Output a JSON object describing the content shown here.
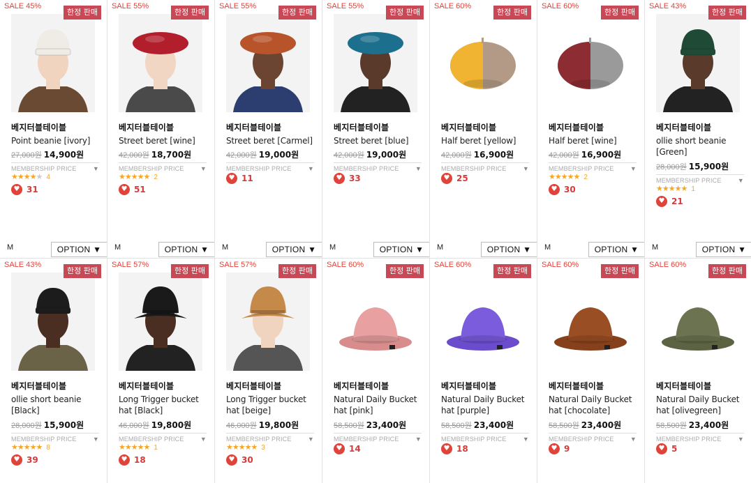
{
  "common": {
    "limited_label": "한정 판매",
    "brand": "베지터블테이블",
    "membership_label": "MEMBERSHIP PRICE",
    "membership_arrow": "▼",
    "option_size": "M",
    "option_label": "OPTION ▼"
  },
  "colors": {
    "sale": "#e0433a",
    "badge": "#c94856",
    "star": "#f5a623",
    "heart": "#e0433a"
  },
  "products": [
    {
      "sale": "SALE 45%",
      "name": "Point beanie [ivory]",
      "old": "27,000원",
      "price": "14,900원",
      "stars_filled": 4,
      "review_count": "4",
      "likes": "31",
      "kind": "beanie",
      "c1": "#efece6",
      "c2": "#6b4a33",
      "skin": "#f0d4c0"
    },
    {
      "sale": "SALE 55%",
      "name": "Street beret [wine]",
      "old": "42,000원",
      "price": "18,700원",
      "stars_filled": 5,
      "review_count": "2",
      "likes": "51",
      "kind": "beret",
      "c1": "#b31e2c",
      "c2": "#4a4a4a",
      "skin": "#f2d6c4"
    },
    {
      "sale": "SALE 55%",
      "name": "Street beret [Carmel]",
      "old": "42,000원",
      "price": "19,000원",
      "stars_filled": 0,
      "review_count": "",
      "likes": "11",
      "kind": "beret",
      "c1": "#b8542a",
      "c2": "#2c3e70",
      "skin": "#6b4532"
    },
    {
      "sale": "SALE 55%",
      "name": "Street beret [blue]",
      "old": "42,000원",
      "price": "19,000원",
      "stars_filled": 0,
      "review_count": "",
      "likes": "33",
      "kind": "beret",
      "c1": "#1d6f8e",
      "c2": "#222",
      "skin": "#5a3a2a"
    },
    {
      "sale": "SALE 60%",
      "name": "Half beret [yellow]",
      "old": "42,000원",
      "price": "16,900원",
      "stars_filled": 0,
      "review_count": "",
      "likes": "25",
      "kind": "halfberet",
      "c1": "#f0b432",
      "c2": "#b39a86",
      "skin": ""
    },
    {
      "sale": "SALE 60%",
      "name": "Half beret [wine]",
      "old": "42,000원",
      "price": "16,900원",
      "stars_filled": 5,
      "review_count": "2",
      "likes": "30",
      "kind": "halfberet",
      "c1": "#8e2c33",
      "c2": "#9a9a9a",
      "skin": ""
    },
    {
      "sale": "SALE 43%",
      "name": "ollie short beanie [Green]",
      "old": "28,000원",
      "price": "15,900원",
      "stars_filled": 5,
      "review_count": "1",
      "likes": "21",
      "kind": "beanie",
      "c1": "#1f4a35",
      "c2": "#222",
      "skin": "#5a3a2a"
    },
    {
      "sale": "SALE 43%",
      "name": "ollie short beanie [Black]",
      "old": "28,000원",
      "price": "15,900원",
      "stars_filled": 5,
      "review_count": "8",
      "likes": "39",
      "kind": "beanie",
      "c1": "#1c1c1c",
      "c2": "#6b6347",
      "skin": "#4a2e22"
    },
    {
      "sale": "SALE 57%",
      "name": "Long Trigger bucket hat [Black]",
      "old": "46,000원",
      "price": "19,800원",
      "stars_filled": 5,
      "review_count": "1",
      "likes": "18",
      "kind": "bucketmodel",
      "c1": "#1a1a1a",
      "c2": "#222",
      "skin": "#4a2e22"
    },
    {
      "sale": "SALE 57%",
      "name": "Long Trigger bucket hat [beige]",
      "old": "46,000원",
      "price": "19,800원",
      "stars_filled": 5,
      "review_count": "3",
      "likes": "30",
      "kind": "bucketmodel",
      "c1": "#c58a4a",
      "c2": "#555",
      "skin": "#f0d4c0"
    },
    {
      "sale": "SALE 60%",
      "name": "Natural Daily Bucket hat [pink]",
      "old": "58,500원",
      "price": "23,400원",
      "stars_filled": 0,
      "review_count": "",
      "likes": "14",
      "kind": "bucket",
      "c1": "#e8a1a0",
      "c2": "#d88c8b",
      "skin": ""
    },
    {
      "sale": "SALE 60%",
      "name": "Natural Daily Bucket hat [purple]",
      "old": "58,500원",
      "price": "23,400원",
      "stars_filled": 0,
      "review_count": "",
      "likes": "18",
      "kind": "bucket",
      "c1": "#7b5cdc",
      "c2": "#6a4ccc",
      "skin": ""
    },
    {
      "sale": "SALE 60%",
      "name": "Natural Daily Bucket hat [chocolate]",
      "old": "58,500원",
      "price": "23,400원",
      "stars_filled": 0,
      "review_count": "",
      "likes": "9",
      "kind": "bucket",
      "c1": "#9a4e24",
      "c2": "#86411c",
      "skin": ""
    },
    {
      "sale": "SALE 60%",
      "name": "Natural Daily Bucket hat [olivegreen]",
      "old": "58,500원",
      "price": "23,400원",
      "stars_filled": 0,
      "review_count": "",
      "likes": "5",
      "kind": "bucket",
      "c1": "#6b7350",
      "c2": "#5b6342",
      "skin": ""
    }
  ]
}
